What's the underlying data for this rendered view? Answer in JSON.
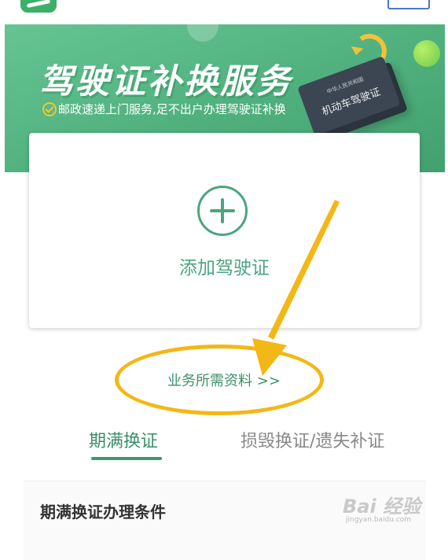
{
  "banner": {
    "title": "驾驶证补换服务",
    "subtitle": "邮政速递上门服务,足不出户办理驾驶证补换",
    "book_small_text": "中华人民共和国",
    "book_title": "机动车驾驶证"
  },
  "card": {
    "add_label": "添加驾驶证"
  },
  "links": {
    "required_docs": "业务所需资料 >>"
  },
  "tabs": [
    {
      "label": "期满换证",
      "active": true
    },
    {
      "label": "损毁换证/遗失补证",
      "active": false
    }
  ],
  "section": {
    "title": "期满换证办理条件"
  },
  "watermark": {
    "text": "Bai 经验",
    "url": "jingyan.baidu.com"
  },
  "colors": {
    "brand_green": "#4aa57f",
    "banner_green": "#55b583",
    "annotation_yellow": "#f3b716"
  }
}
